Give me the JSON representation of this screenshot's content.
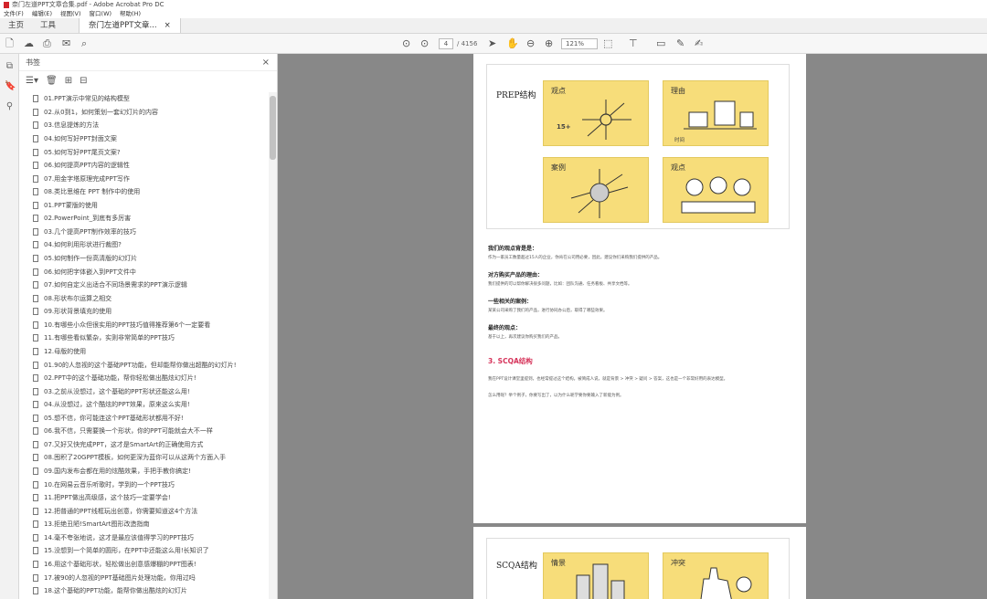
{
  "window": {
    "title": "奈门左道PPT文章合集.pdf - Adobe Acrobat Pro DC"
  },
  "menu": [
    "文件(F)",
    "编辑(E)",
    "视图(V)",
    "窗口(W)",
    "帮助(H)"
  ],
  "tabs": {
    "home": "主页",
    "tools": "工具",
    "doc": "奈门左道PPT文章...",
    "doc_close": "×"
  },
  "toolbar": {
    "page_current": "4",
    "page_total": "/ 4156",
    "zoom": "121%"
  },
  "bookmarks": {
    "title": "书签",
    "items": [
      "01.PPT演示中常见的结构模型",
      "02.从0到1，如何策划一套幻灯片的内容",
      "03.信息提炼的方法",
      "04.如何写好PPT封面文案",
      "05.如何写好PPT尾页文案?",
      "06.如何提高PPT内容的逻辑性",
      "07.用金字塔原理完成PPT写作",
      "08.类比思维在 PPT 制作中的使用",
      "01.PPT蒙版的使用",
      "02.PowerPoint_到底有多厉害",
      "03.几个提高PPT制作效率的技巧",
      "04.如何利用形状进行裁图?",
      "05.如何制作一份高清版的幻灯片",
      "06.如何把字体嵌入到PPT文件中",
      "07.如何自定义出适合不同场景需求的PPT演示逻辑",
      "08.形状布尔运算之相交",
      "09.形状背景填充的使用",
      "10.有哪些小众但很实用的PPT技巧值得推荐第6个一定要看",
      "11.有哪些看似繁杂，实则非常简单的PPT技巧",
      "12.母版的使用",
      "01.90的人忽视的这个基础PPT功能，但却能帮你做出超酷的幻灯片!",
      "02.PPT中的这个基础功能，帮你轻松做出酷炫幻灯片!",
      "03.之前从没想过，这个基础的PPT形状还能这么用!",
      "04.从没想过，这个酷炫的PPT效果，原来这么实用!",
      "05.想不信，你可能连这个PPT基础形状都用不好!",
      "06.我不信，只需要换一个形状，你的PPT可能就会大不一样",
      "07.又好又快完成PPT，这才是SmartArt的正确使用方式",
      "08.囤积了20GPPT模板，如何更深为蓝你可以从这两个方面入手",
      "09.国内发布会都在用的炫酷效果，手把手教你搞定!",
      "10.在网易云音乐听歌时，学到的一个PPT技巧",
      "11.把PPT做出高级感，这个技巧一定要学会!",
      "12.把普通的PPT线框玩出创意，你需要知道这4个方法",
      "13.拒绝丑陋!SmartArt图形改造指南",
      "14.毫不夸张地说，这才是最应该值得学习的PPT技巧",
      "15.没想到一个简单的圆形，在PPT中还能这么用!长知识了",
      "16.用这个基础形状，轻松做出创意感爆棚的PPT图表!",
      "17.被90的人忽视的PPT基础图片处理功能，你用过吗",
      "18.这个基础的PPT功能，能帮你做出酷炫的幻灯片"
    ]
  },
  "page1": {
    "slide_title": "PREP结构",
    "panels": [
      {
        "label": "观点",
        "caption": "15+"
      },
      {
        "label": "理由",
        "caption": "时间"
      },
      {
        "label": "案例",
        "caption": ""
      },
      {
        "label": "观点",
        "caption": ""
      }
    ],
    "blocks": [
      {
        "head": "我们的观点背是是：",
        "body": "作为一家员工数量超过15人的企业，你肯在公司用必要，因此，建议你们采购我们提供的产品。"
      },
      {
        "head": "对方购买产品的理由：",
        "body": "我们提供的可以帮你解决很多问题，比如：团队沟通、任务看板、共享文档等。"
      },
      {
        "head": "一些相关的案例：",
        "body": "某某公司采购了我们的产品，进行协同办公后，取得了哪些效果。"
      },
      {
        "head": "最终的观点：",
        "body": "基于以上，再次建议你购买我们的产品。"
      }
    ],
    "section_title": "3. SCQA结构",
    "section_p1": "我在PPT设计课堂里提到，也经常提过这个结构。被简成人说，就是背景 > 冲突 > 疑问 > 答案，这也是一个非常好用的表达模型。",
    "section_p2": "怎么用呢？举个例子，你要写出了，以为什么呢学要你要输入了新能为例。"
  },
  "page2": {
    "slide_title": "SCQA结构",
    "panels": [
      {
        "label": "情景"
      },
      {
        "label": "冲突"
      }
    ]
  },
  "colors": {
    "accent": "#d6335a",
    "panel": "#f7dd7a",
    "viewer_bg": "#888888"
  }
}
